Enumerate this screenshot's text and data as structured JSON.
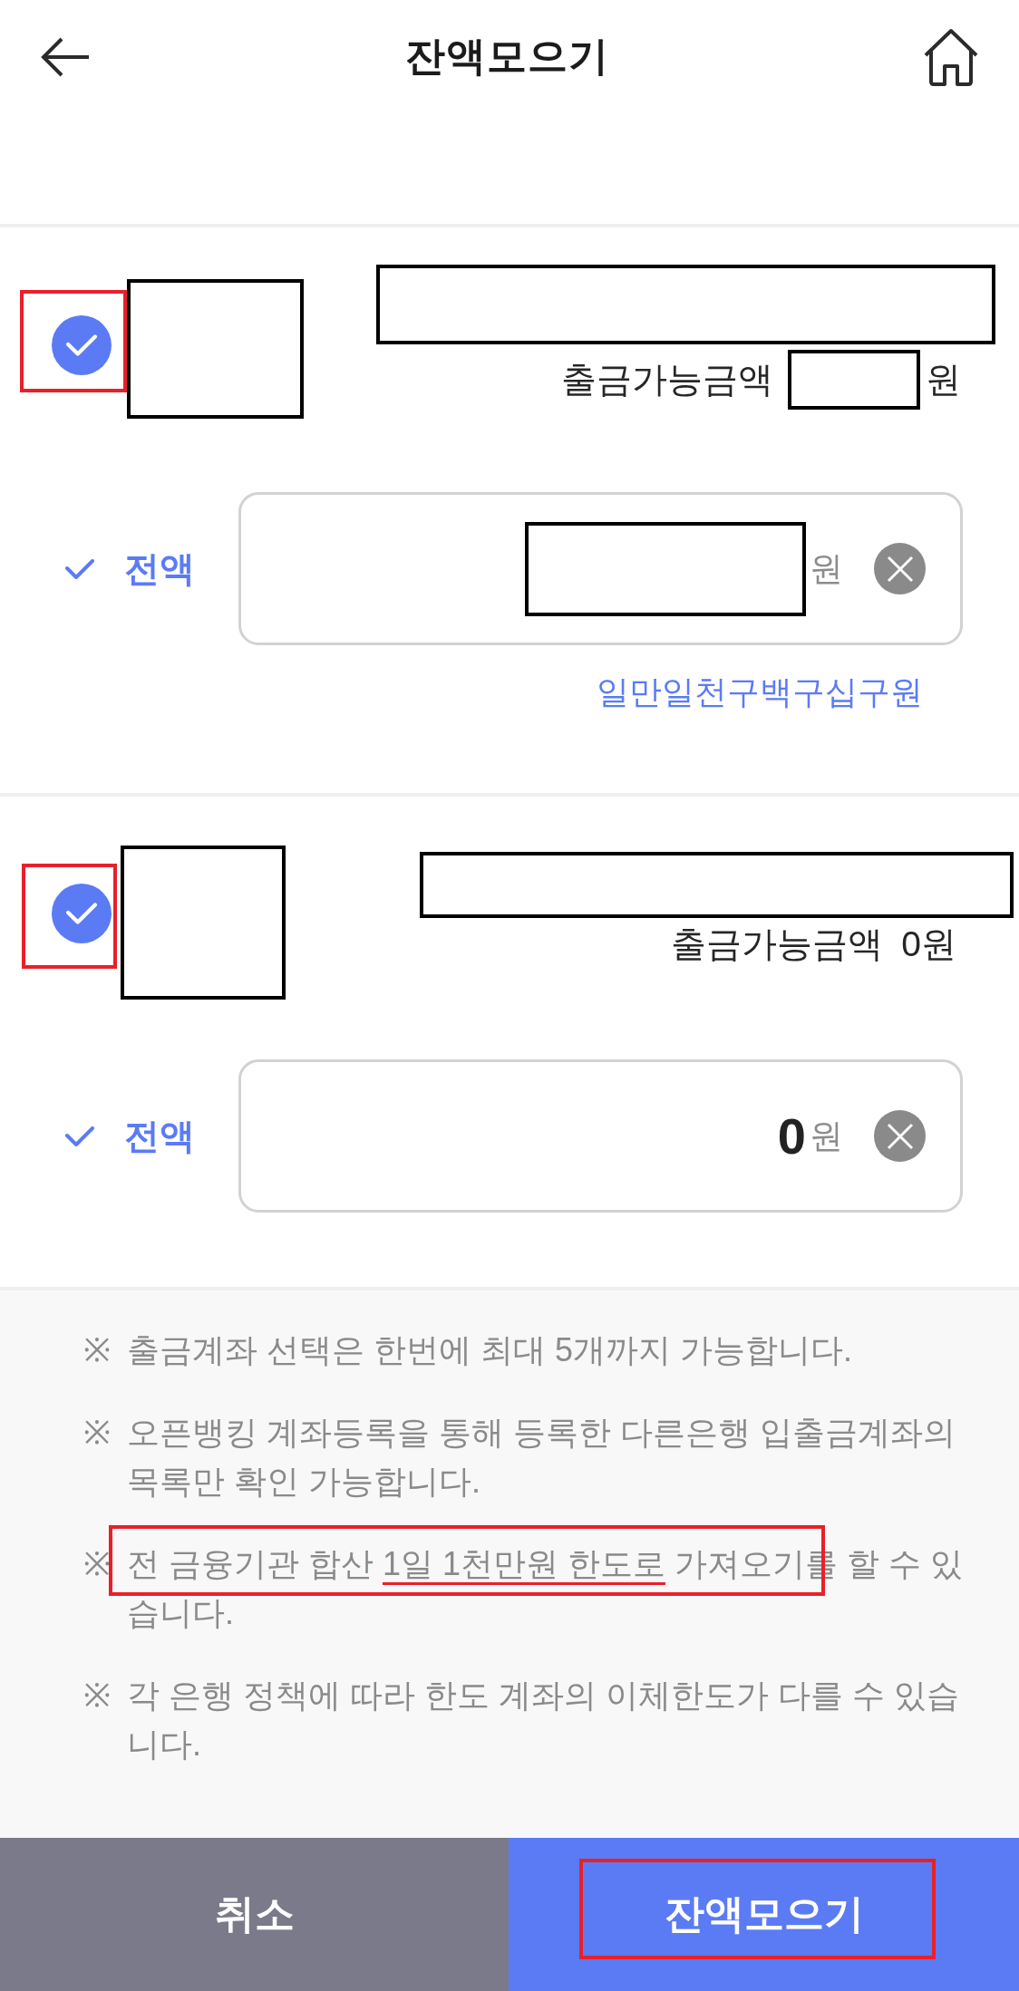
{
  "header": {
    "title": "잔액모으기"
  },
  "accounts": [
    {
      "checked": true,
      "highlighted": true,
      "logo_redacted": true,
      "name_redacted": true,
      "available": {
        "label": "출금가능금액",
        "amount_redacted": true,
        "unit": "원"
      },
      "full_amount": {
        "label": "전액",
        "checked": true
      },
      "amount": {
        "value_redacted": true,
        "unit": "원"
      },
      "amount_in_words": "일만일천구백구십구원"
    },
    {
      "checked": true,
      "highlighted": true,
      "logo_redacted": true,
      "name_redacted": true,
      "available": {
        "label": "출금가능금액",
        "amount": "0",
        "unit": "원"
      },
      "full_amount": {
        "label": "전액",
        "checked": true
      },
      "amount": {
        "value": "0",
        "unit": "원"
      }
    }
  ],
  "notes": [
    {
      "mark": "※",
      "highlighted": false,
      "segments": [
        {
          "text": "출금계좌 선택은 한번에 최대 5개까지 가능합니다.",
          "underlined": false
        }
      ]
    },
    {
      "mark": "※",
      "highlighted": false,
      "segments": [
        {
          "text": "오픈뱅킹 계좌등록을 통해 등록한 다른은행 입출금계좌의 목록만 확인 가능합니다.",
          "underlined": false
        }
      ]
    },
    {
      "mark": "※",
      "highlighted": true,
      "segments": [
        {
          "text": "전 금융기관 합산 ",
          "underlined": false
        },
        {
          "text": "1일 1천만원 한도로",
          "underlined": true
        },
        {
          "text": " 가져오기를 할 수 있습니다.",
          "underlined": false
        }
      ]
    },
    {
      "mark": "※",
      "highlighted": false,
      "segments": [
        {
          "text": "각 은행 정책에 따라 한도 계좌의 이체한도가 다를 수 있습니다.",
          "underlined": false
        }
      ]
    }
  ],
  "buttons": [
    {
      "label": "취소",
      "kind": "cancel",
      "highlighted": false
    },
    {
      "label": "잔액모으기",
      "kind": "primary",
      "highlighted": true
    }
  ]
}
